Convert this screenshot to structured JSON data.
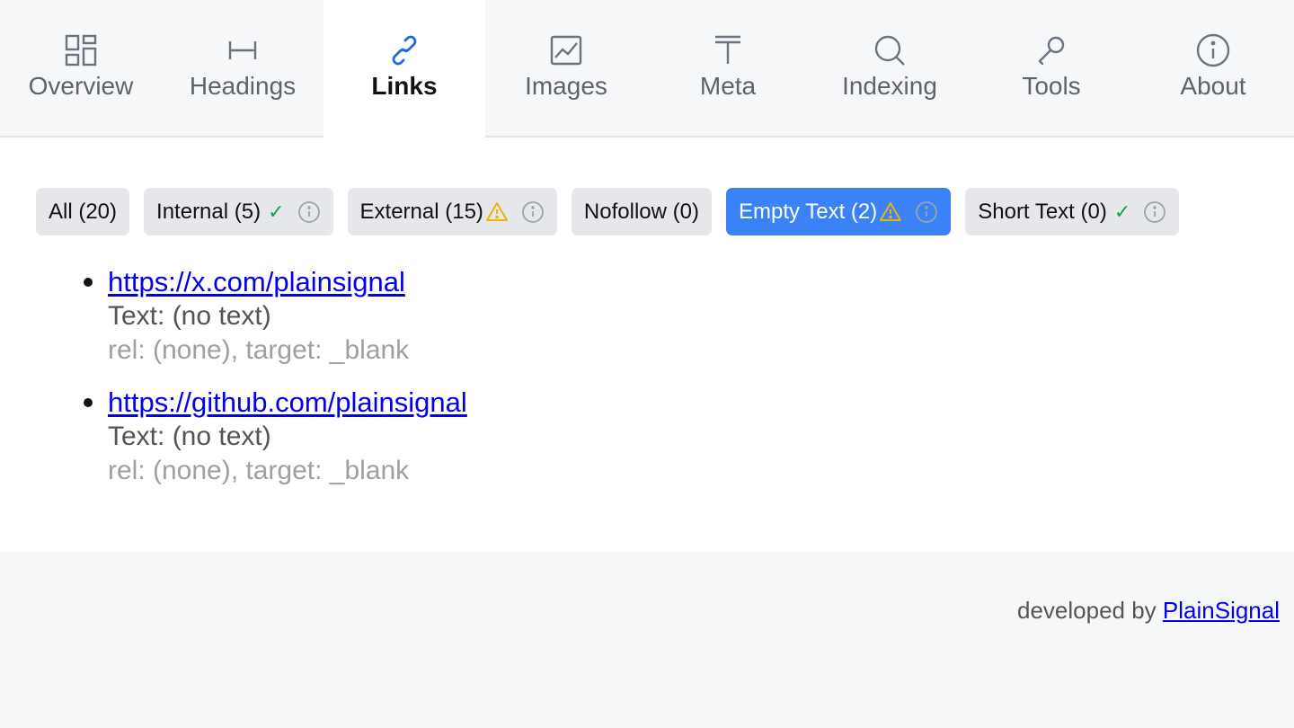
{
  "tabs": [
    {
      "label": "Overview",
      "icon": "grid-icon",
      "active": false
    },
    {
      "label": "Headings",
      "icon": "heading-icon",
      "active": false
    },
    {
      "label": "Links",
      "icon": "link-icon",
      "active": true
    },
    {
      "label": "Images",
      "icon": "image-icon",
      "active": false
    },
    {
      "label": "Meta",
      "icon": "text-icon",
      "active": false
    },
    {
      "label": "Indexing",
      "icon": "search-icon",
      "active": false
    },
    {
      "label": "Tools",
      "icon": "wrench-icon",
      "active": false
    },
    {
      "label": "About",
      "icon": "info-icon",
      "active": false
    }
  ],
  "filters": [
    {
      "label": "All (20)",
      "status": "none",
      "info": false,
      "active": false
    },
    {
      "label": "Internal (5)",
      "status": "check",
      "info": true,
      "active": false
    },
    {
      "label": "External (15)",
      "status": "warning",
      "info": true,
      "active": false
    },
    {
      "label": "Nofollow (0)",
      "status": "none",
      "info": false,
      "active": false
    },
    {
      "label": "Empty Text (2)",
      "status": "warning",
      "info": true,
      "active": true
    },
    {
      "label": "Short Text (0)",
      "status": "check",
      "info": true,
      "active": false
    }
  ],
  "links": [
    {
      "url": "https://x.com/plainsignal",
      "text": "Text: (no text)",
      "meta": "rel: (none), target: _blank"
    },
    {
      "url": "https://github.com/plainsignal",
      "text": "Text: (no text)",
      "meta": "rel: (none), target: _blank"
    }
  ],
  "footer": {
    "prefix": "developed by ",
    "link": "PlainSignal"
  },
  "colors": {
    "accent": "#3b82f6",
    "active_icon": "#2563eb",
    "warning": "#eab308",
    "check": "#16a34a",
    "link": "#0000ee"
  }
}
